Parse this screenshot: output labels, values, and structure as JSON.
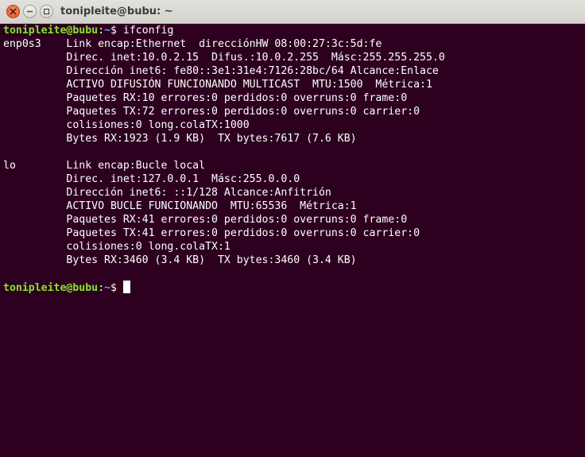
{
  "window": {
    "title": "tonipleite@bubu: ~"
  },
  "icons": {
    "close": "close-icon",
    "minimize": "minimize-icon",
    "maximize": "maximize-icon"
  },
  "colors": {
    "background": "#2c001e",
    "prompt_user": "#8ae234",
    "prompt_path": "#729fcf",
    "text": "#ffffff",
    "close_button": "#e4531f"
  },
  "prompt": {
    "user_host": "tonipleite@bubu",
    "separator": ":",
    "path": "~",
    "symbol": "$ "
  },
  "commands": {
    "first": "ifconfig"
  },
  "output": [
    "enp0s3    Link encap:Ethernet  direcciónHW 08:00:27:3c:5d:fe  ",
    "          Direc. inet:10.0.2.15  Difus.:10.0.2.255  Másc:255.255.255.0",
    "          Dirección inet6: fe80::3e1:31e4:7126:28bc/64 Alcance:Enlace",
    "          ACTIVO DIFUSIÓN FUNCIONANDO MULTICAST  MTU:1500  Métrica:1",
    "          Paquetes RX:10 errores:0 perdidos:0 overruns:0 frame:0",
    "          Paquetes TX:72 errores:0 perdidos:0 overruns:0 carrier:0",
    "          colisiones:0 long.colaTX:1000 ",
    "          Bytes RX:1923 (1.9 KB)  TX bytes:7617 (7.6 KB)",
    "",
    "lo        Link encap:Bucle local  ",
    "          Direc. inet:127.0.0.1  Másc:255.0.0.0",
    "          Dirección inet6: ::1/128 Alcance:Anfitrión",
    "          ACTIVO BUCLE FUNCIONANDO  MTU:65536  Métrica:1",
    "          Paquetes RX:41 errores:0 perdidos:0 overruns:0 frame:0",
    "          Paquetes TX:41 errores:0 perdidos:0 overruns:0 carrier:0",
    "          colisiones:0 long.colaTX:1 ",
    "          Bytes RX:3460 (3.4 KB)  TX bytes:3460 (3.4 KB)",
    ""
  ]
}
